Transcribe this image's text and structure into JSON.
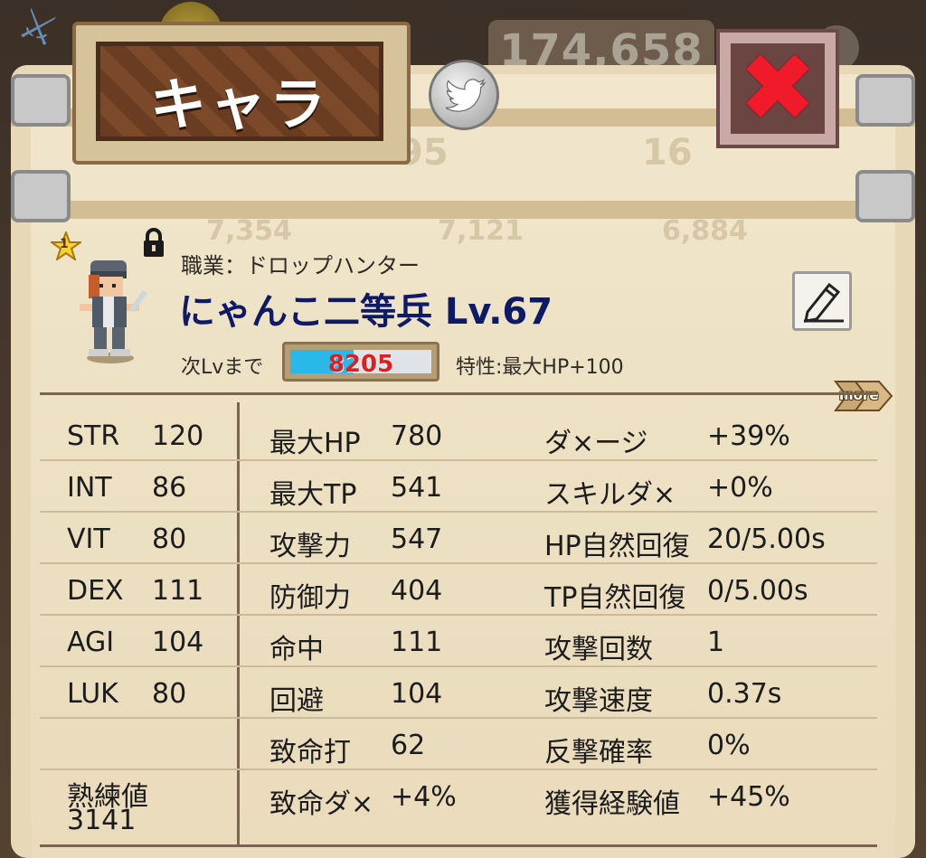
{
  "background": {
    "gold": "174,658",
    "faint_values": [
      "95",
      "16",
      "7,354",
      "7,121",
      "6,884"
    ]
  },
  "header": {
    "title": "キャラ",
    "twitter_icon": "twitter-bird-icon",
    "close_icon": "close-x-icon"
  },
  "character": {
    "rank": "1",
    "job": "職業：ドロップハンター",
    "name": "にゃんこ二等兵 Lv.67",
    "next_level_label": "次Lvまで",
    "exp_remaining": "8205",
    "exp_fill_fraction": 0.45,
    "trait": "特性:最大HP+100",
    "more_label": "more"
  },
  "base_stats": [
    {
      "label": "STR",
      "value": "120"
    },
    {
      "label": "INT",
      "value": "86"
    },
    {
      "label": "VIT",
      "value": "80"
    },
    {
      "label": "DEX",
      "value": "111"
    },
    {
      "label": "AGI",
      "value": "104"
    },
    {
      "label": "LUK",
      "value": "80"
    }
  ],
  "proficiency": {
    "label": "熟練値",
    "value": "3141"
  },
  "combat_stats": [
    {
      "label": "最大HP",
      "value": "780"
    },
    {
      "label": "最大TP",
      "value": "541"
    },
    {
      "label": "攻撃力",
      "value": "547"
    },
    {
      "label": "防御力",
      "value": "404"
    },
    {
      "label": "命中",
      "value": "111"
    },
    {
      "label": "回避",
      "value": "104"
    },
    {
      "label": "致命打",
      "value": "62"
    },
    {
      "label": "致命ダ×",
      "value": "+4%"
    }
  ],
  "extra_stats": [
    {
      "label": "ダ×ージ",
      "value": "+39%"
    },
    {
      "label": "スキルダ×",
      "value": "+0%"
    },
    {
      "label": "HP自然回復",
      "value": "20/5.00s"
    },
    {
      "label": "TP自然回復",
      "value": "0/5.00s"
    },
    {
      "label": "攻撃回数",
      "value": "1"
    },
    {
      "label": "攻撃速度",
      "value": "0.37s"
    },
    {
      "label": "反撃確率",
      "value": "0%"
    },
    {
      "label": "獲得経験値",
      "value": "+45%"
    }
  ],
  "colors": {
    "panel": "#e7d8b8",
    "name": "#0e1a66",
    "exp_fill": "#2ab8e8",
    "exp_text": "#e01e1e",
    "close_x": "#f01a2a"
  }
}
